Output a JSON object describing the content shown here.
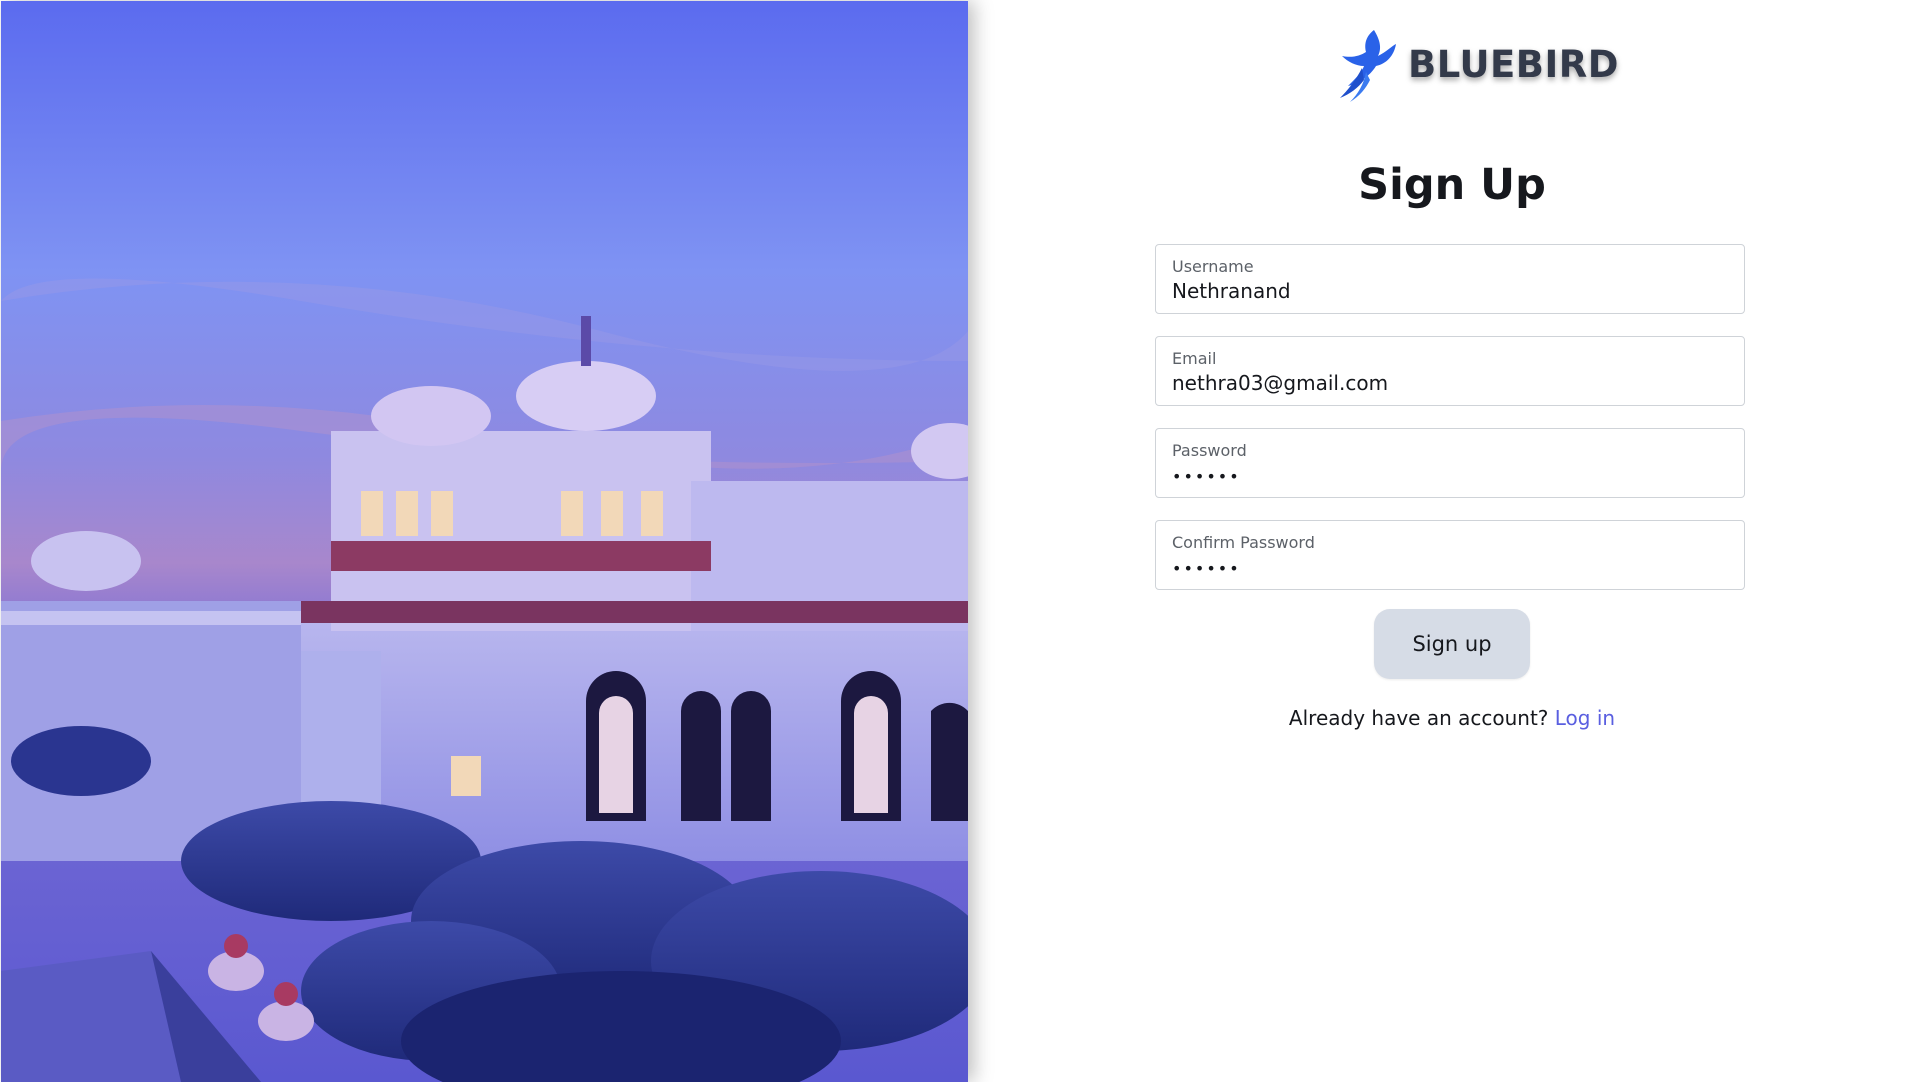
{
  "hero": {
    "image_description_icon": "palace-photo"
  },
  "brand": {
    "name": "BLUEBIRD",
    "icon": "bluebird-logo-icon",
    "accent_color": "#2a62e8"
  },
  "form": {
    "title": "Sign Up",
    "fields": [
      {
        "label": "Username",
        "value": "Nethranand"
      },
      {
        "label": "Email",
        "value": "nethra03@gmail.com"
      },
      {
        "label": "Password",
        "value": "••••••"
      },
      {
        "label": "Confirm Password",
        "value": "••••••"
      }
    ],
    "submit_label": "Sign up",
    "account_prompt": "Already have an account?",
    "login_link": "Log in"
  },
  "colors": {
    "link": "#5a5fe0",
    "button_bg": "#d6dce6",
    "field_border": "#cfd3d8"
  }
}
